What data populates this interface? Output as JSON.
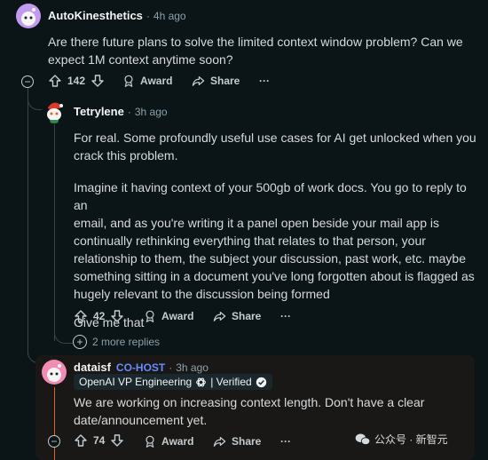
{
  "comment1": {
    "username": "AutoKinesthetics",
    "time": "4h ago",
    "lines": [
      "Are there future plans to solve the limited context window problem? Can we",
      "expect 1M context anytime soon?"
    ],
    "votes": "142",
    "award_label": "Award",
    "share_label": "Share",
    "more_label": "···"
  },
  "comment2": {
    "username": "Tetrylene",
    "time": "3h ago",
    "paragraphs": [
      [
        "For real. Some profoundly useful use cases for AI get unlocked when you",
        "crack this problem."
      ],
      [
        "Imagine it having context of your 500gb of work docs. You go to reply to an",
        "email, and as you're writing it a panel open beside your mail app is",
        "continually rethinking everything that relates to that person, your",
        "relationship to them, the subject your discussion, past work, etc. maybe",
        "something sitting in a document you've long forgotten about is flagged as",
        "hugely relevant to the discussion being formed"
      ],
      [
        "Give me that"
      ]
    ],
    "votes": "42",
    "award_label": "Award",
    "share_label": "Share",
    "more_label": "···",
    "more_replies": "2 more replies"
  },
  "comment3": {
    "username": "dataisf",
    "tag": "CO-HOST",
    "time": "3h ago",
    "flair": "OpenAI VP Engineering",
    "flair_suffix": "| Verified",
    "lines": [
      "We are working on increasing context length. Don't have a clear",
      "date/announcement yet."
    ],
    "votes": "74",
    "award_label": "Award",
    "share_label": "Share",
    "more_label": "···"
  },
  "watermark": {
    "text": "公众号 · 新智元"
  },
  "colors": {
    "background": "#0b1416",
    "cohost": "#648efc",
    "avatar1": "#c29af0",
    "avatar3": "#f38cb5"
  }
}
